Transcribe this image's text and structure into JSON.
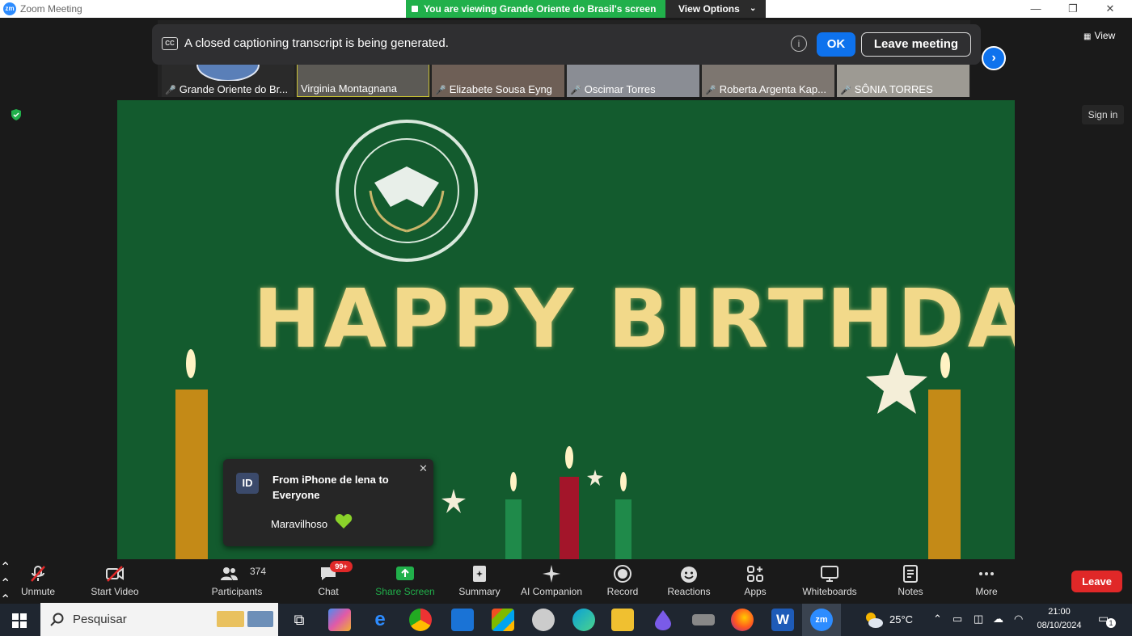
{
  "window": {
    "title": "Zoom Meeting"
  },
  "banner": {
    "text": "You are viewing Grande Oriente do Brasil's screen",
    "view_options": "View Options"
  },
  "captions": {
    "text": "A closed captioning transcript is being generated.",
    "ok": "OK",
    "leave_meeting": "Leave meeting"
  },
  "participants_strip": [
    {
      "name": "Grande Oriente do Br..."
    },
    {
      "name": "Virginia Montagnana"
    },
    {
      "name": "Elizabete Sousa Eyng"
    },
    {
      "name": "Oscimar Torres"
    },
    {
      "name": "Roberta Argenta Kap..."
    },
    {
      "name": "SÔNIA TORRES"
    }
  ],
  "top_right": {
    "view": "View",
    "sign_in": "Sign in"
  },
  "shared_content": {
    "headline": "HAPPY BIRTHDAY"
  },
  "chat_popup": {
    "avatar": "ID",
    "from": "From iPhone de lena to Everyone",
    "message": "Maravilhoso"
  },
  "toolbar": {
    "unmute": "Unmute",
    "start_video": "Start Video",
    "participants": "Participants",
    "participants_count": "374",
    "chat": "Chat",
    "chat_badge": "99+",
    "share_screen": "Share Screen",
    "summary": "Summary",
    "ai_companion": "AI Companion",
    "record": "Record",
    "reactions": "Reactions",
    "apps": "Apps",
    "whiteboards": "Whiteboards",
    "notes": "Notes",
    "more": "More",
    "leave": "Leave"
  },
  "taskbar": {
    "search": "Pesquisar",
    "temperature": "25°C",
    "time": "21:00",
    "date": "08/10/2024",
    "notifications": "1"
  },
  "colors": {
    "accent": "#0e72ed",
    "share_green": "#21b04b",
    "leave_red": "#e02828",
    "slide_bg": "#135b2e"
  }
}
